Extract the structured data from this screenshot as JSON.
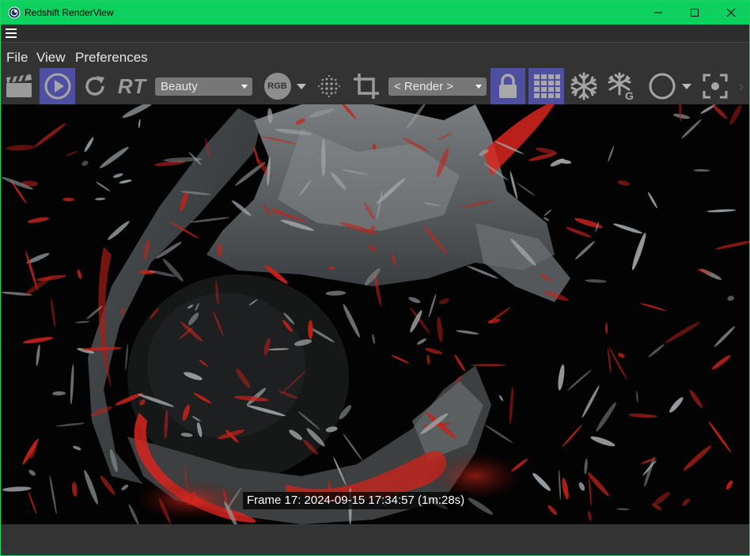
{
  "window": {
    "title": "Redshift RenderView",
    "controls": {
      "minimize": "minimize-icon",
      "maximize": "maximize-icon",
      "close": "close-icon"
    }
  },
  "menu": {
    "items": [
      {
        "label": "File"
      },
      {
        "label": "View"
      },
      {
        "label": "Preferences"
      }
    ]
  },
  "toolbar": {
    "rt_label": "RT",
    "aov_select": {
      "value": "Beauty"
    },
    "rgb_label": "RGB",
    "snapshot_select": {
      "value": "< Render >"
    },
    "g_label": "G",
    "icons": [
      "clapper-icon",
      "play-icon",
      "refresh-icon",
      "rgb-channel-icon",
      "dots-grid-icon",
      "crop-icon",
      "lock-icon",
      "bucket-grid-icon",
      "snowflake-icon",
      "snowflake-g-icon",
      "circle-icon",
      "focus-target-icon"
    ],
    "active": [
      "play-button",
      "lock-button",
      "bucket-grid-button"
    ]
  },
  "render": {
    "caption": "Frame  17:  2024-09-15  17:34:57  (1m:28s)"
  },
  "colors": {
    "title_bar": "#0ed05f",
    "toolbar_bg": "#333333",
    "active_button": "#4e4fa0",
    "accent_red": "#d6221c"
  }
}
